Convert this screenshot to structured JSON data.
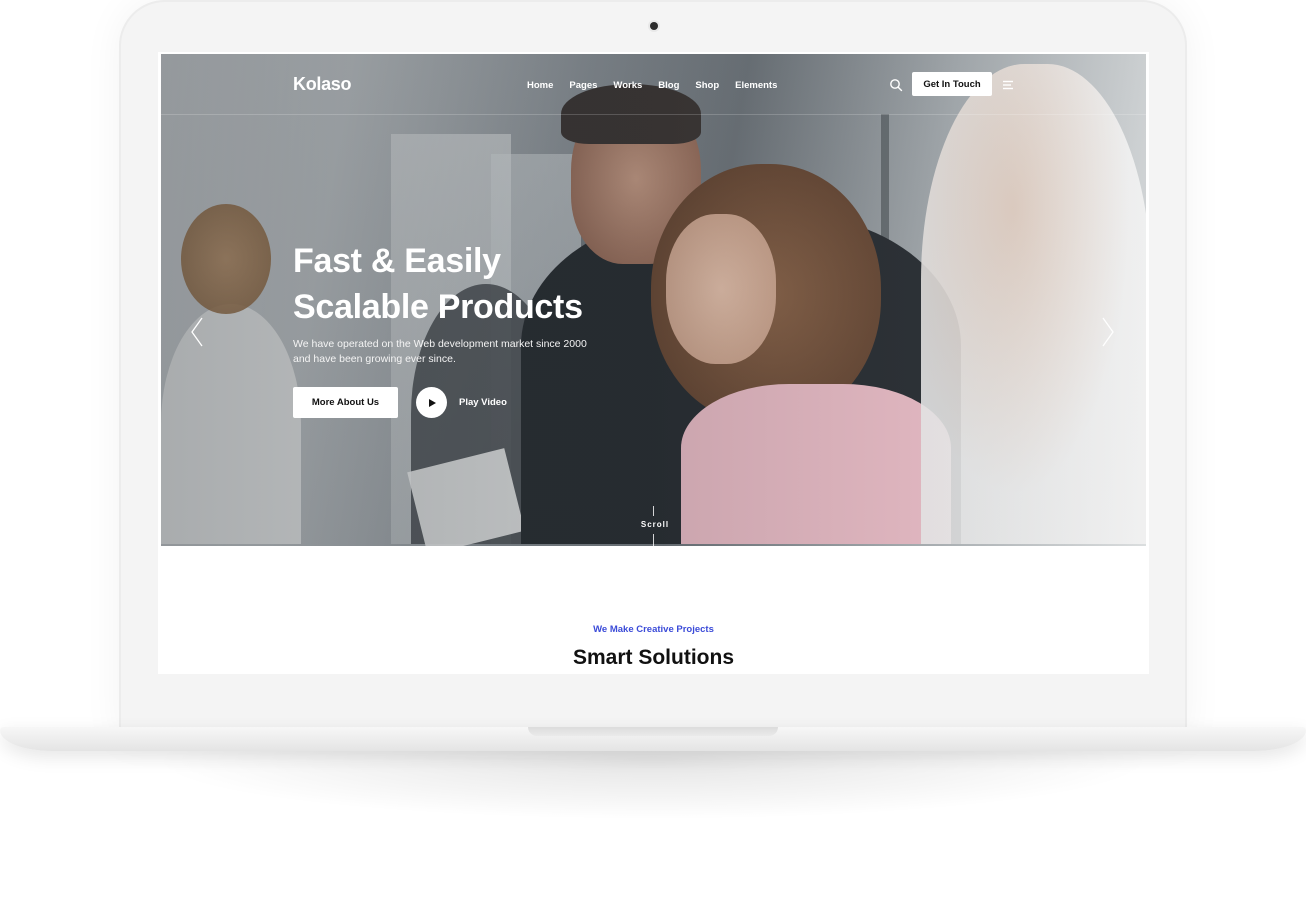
{
  "brand": {
    "logo_text": "Kolaso"
  },
  "nav": {
    "items": [
      "Home",
      "Pages",
      "Works",
      "Blog",
      "Shop",
      "Elements"
    ],
    "cta_label": "Get In Touch"
  },
  "hero": {
    "title_line1": "Fast & Easily",
    "title_line2": "Scalable Products",
    "subtitle": "We have operated on the Web development market since 2000 and have been growing ever since.",
    "primary_button": "More About Us",
    "play_label": "Play Video",
    "scroll_label": "Scroll"
  },
  "section": {
    "eyebrow": "We Make Creative Projects",
    "title": "Smart Solutions"
  },
  "colors": {
    "accent": "#3b4bd8",
    "text_dark": "#111111",
    "white": "#ffffff"
  },
  "icons": [
    "search-icon",
    "menu-icon",
    "play-icon",
    "chevron-left-icon",
    "chevron-right-icon"
  ]
}
